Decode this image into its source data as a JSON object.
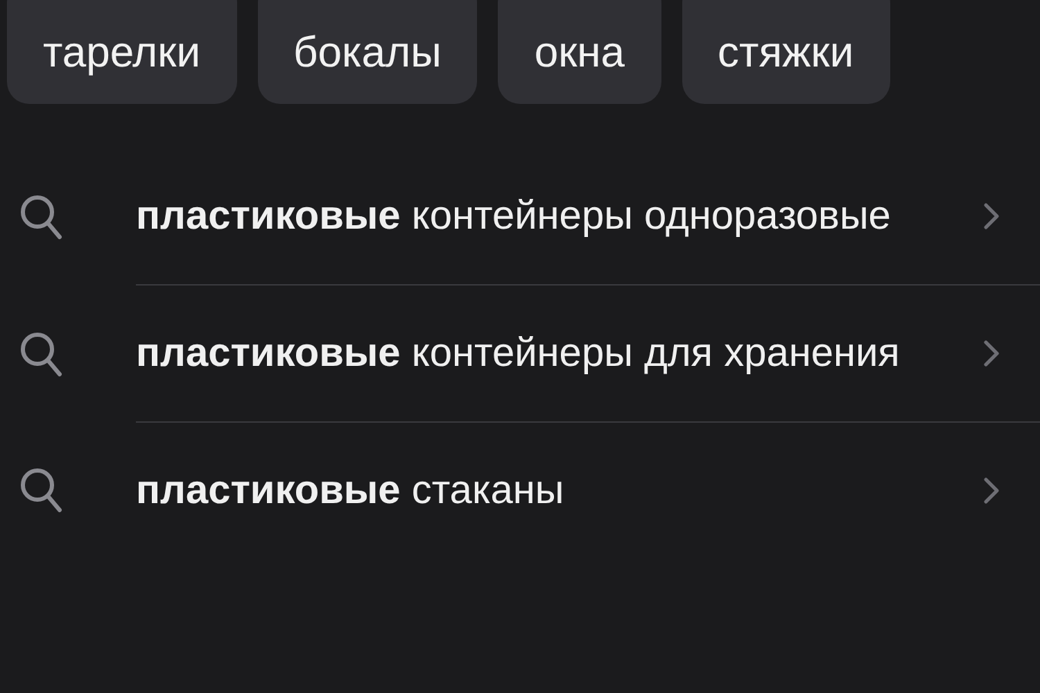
{
  "chips": [
    {
      "label": "тарелки"
    },
    {
      "label": "бокалы"
    },
    {
      "label": "окна"
    },
    {
      "label": "стяжки"
    }
  ],
  "suggestions": [
    {
      "text": "**пластиковые** контейнеры одноразовые"
    },
    {
      "text": "**пластиковые** контейнеры для хранения"
    },
    {
      "text": "**пластиковые** стаканы"
    }
  ]
}
